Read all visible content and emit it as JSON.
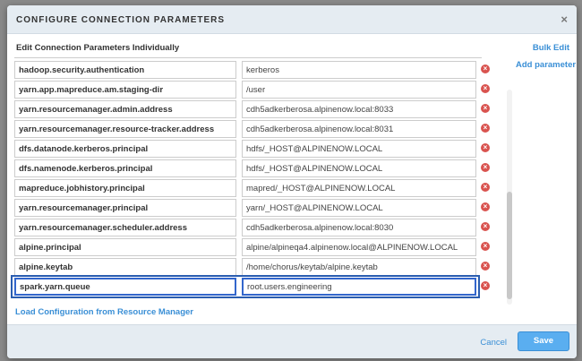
{
  "modal": {
    "title": "CONFIGURE CONNECTION PARAMETERS",
    "close_label": "×",
    "subtitle": "Edit Connection Parameters Individually",
    "bulk_edit_label": "Bulk Edit",
    "add_parameter_label": "Add parameter",
    "load_config_label": "Load Configuration from Resource Manager",
    "cancel_label": "Cancel",
    "save_label": "Save",
    "remove_icon_glyph": "×"
  },
  "params": [
    {
      "key": "hadoop.security.authentication",
      "value": "kerberos"
    },
    {
      "key": "yarn.app.mapreduce.am.staging-dir",
      "value": "/user"
    },
    {
      "key": "yarn.resourcemanager.admin.address",
      "value": "cdh5adkerberosa.alpinenow.local:8033"
    },
    {
      "key": "yarn.resourcemanager.resource-tracker.address",
      "value": "cdh5adkerberosa.alpinenow.local:8031"
    },
    {
      "key": "dfs.datanode.kerberos.principal",
      "value": "hdfs/_HOST@ALPINENOW.LOCAL"
    },
    {
      "key": "dfs.namenode.kerberos.principal",
      "value": "hdfs/_HOST@ALPINENOW.LOCAL"
    },
    {
      "key": "mapreduce.jobhistory.principal",
      "value": "mapred/_HOST@ALPINENOW.LOCAL"
    },
    {
      "key": "yarn.resourcemanager.principal",
      "value": "yarn/_HOST@ALPINENOW.LOCAL"
    },
    {
      "key": "yarn.resourcemanager.scheduler.address",
      "value": "cdh5adkerberosa.alpinenow.local:8030"
    },
    {
      "key": "alpine.principal",
      "value": "alpine/alpineqa4.alpinenow.local@ALPINENOW.LOCAL"
    },
    {
      "key": "alpine.keytab",
      "value": "/home/chorus/keytab/alpine.keytab"
    },
    {
      "key": "spark.yarn.queue",
      "value": "root.users.engineering"
    }
  ],
  "colors": {
    "accent": "#3a8fd6",
    "remove": "#d9534f",
    "highlight": "#2a5db0"
  }
}
